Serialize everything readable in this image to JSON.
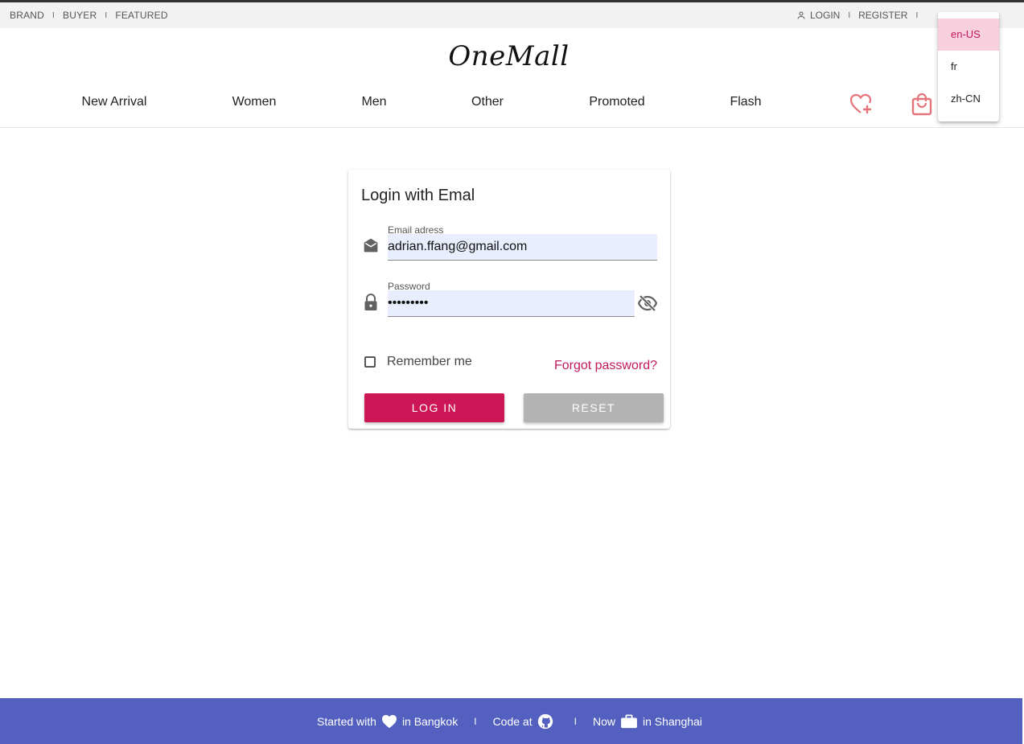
{
  "topbar": {
    "left_links": [
      "BRAND",
      "BUYER",
      "FEATURED"
    ],
    "separator": "I",
    "login": "LOGIN",
    "register": "REGISTER",
    "trailing_separator": "I"
  },
  "brand": {
    "logo_text": "OneMall"
  },
  "nav": {
    "items": [
      "New Arrival",
      "Women",
      "Men",
      "Other",
      "Promoted",
      "Flash"
    ],
    "icons": [
      "heart-plus-icon",
      "shopping-bag-icon"
    ],
    "icon_color": "#e5737a"
  },
  "login_card": {
    "title": "Login with Emal",
    "email": {
      "label": "Email adress",
      "value": "adrian.ffang@gmail.com"
    },
    "password": {
      "label": "Password",
      "value": "•••••••••"
    },
    "remember_label": "Remember me",
    "forgot_label": "Forgot password?",
    "login_button": "LOG IN",
    "reset_button": "RESET"
  },
  "language_menu": {
    "options": [
      "en-US",
      "fr",
      "zh-CN"
    ],
    "selected": "en-US"
  },
  "footer": {
    "started_with": "Started with",
    "in_bangkok": "in Bangkok",
    "separator": "I",
    "code_at": "Code at",
    "now": "Now",
    "in_shanghai": "in Shanghai"
  },
  "colors": {
    "accent": "#cc1656",
    "footer_bg": "#5360bf",
    "input_fill": "#e8eefd",
    "reset_bg": "#b3b3b3"
  }
}
